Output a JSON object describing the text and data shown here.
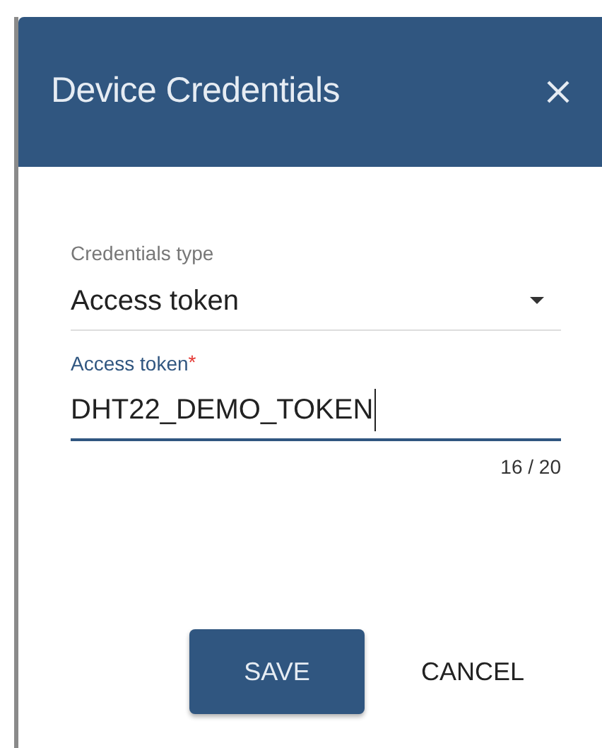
{
  "dialog": {
    "title": "Device Credentials"
  },
  "fields": [
    {
      "kind": "select",
      "label": "Credentials type",
      "value": "Access token",
      "focused": false
    },
    {
      "kind": "text",
      "label": "Access token",
      "required_mark": "*",
      "value": "DHT22_DEMO_TOKEN",
      "focused": true,
      "counter": "16 / 20"
    }
  ],
  "buttons": [
    {
      "label": "SAVE",
      "kind": "primary"
    },
    {
      "label": "CANCEL",
      "kind": "flat"
    }
  ]
}
